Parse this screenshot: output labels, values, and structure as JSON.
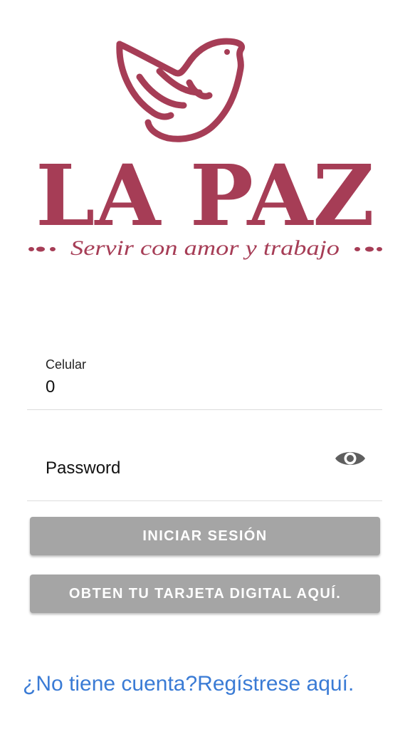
{
  "brand": {
    "name": "LA PAZ",
    "slogan": "Servir con amor y trabajo",
    "color": "#a63d56"
  },
  "form": {
    "celular": {
      "label": "Celular",
      "value": "0"
    },
    "password": {
      "placeholder": "Password",
      "toggle_icon": "eye-icon"
    }
  },
  "buttons": {
    "login": "INICIAR SESIÓN",
    "digital_card": "OBTEN TU TARJETA DIGITAL AQUÍ."
  },
  "register_link": "¿No tiene cuenta?Regístrese aquí.",
  "colors": {
    "button_bg": "#a5a5a5",
    "link": "#3a7bd5"
  }
}
